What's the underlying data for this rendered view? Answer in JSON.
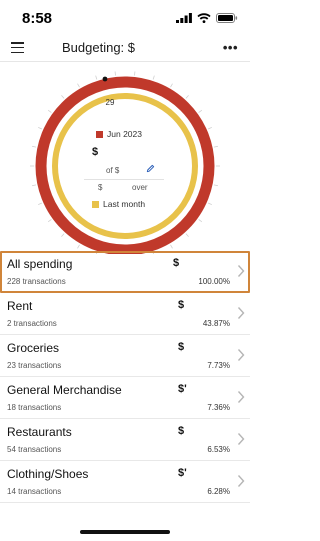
{
  "status_bar": {
    "time": "8:58"
  },
  "header": {
    "title": "Budgeting: $"
  },
  "gauge": {
    "day_label": "29",
    "current_period_label": "Jun 2023",
    "spent_amount": "$",
    "of_budget": "of $",
    "difference_currency": "$",
    "difference_label": "over",
    "previous_period_label": "Last month",
    "current_color": "#c0392b",
    "previous_color": "#e8c24a"
  },
  "categories": [
    {
      "name": "All spending",
      "count": "228 transactions",
      "amount": "$",
      "percent": "100.00%"
    },
    {
      "name": "Rent",
      "count": "2 transactions",
      "amount": "$",
      "percent": "43.87%"
    },
    {
      "name": "Groceries",
      "count": "23 transactions",
      "amount": "$",
      "percent": "7.73%"
    },
    {
      "name": "General Merchandise",
      "count": "18 transactions",
      "amount": "$'",
      "percent": "7.36%"
    },
    {
      "name": "Restaurants",
      "count": "54 transactions",
      "amount": "$",
      "percent": "6.53%"
    },
    {
      "name": "Clothing/Shoes",
      "count": "14 transactions",
      "amount": "$'",
      "percent": "6.28%"
    }
  ]
}
